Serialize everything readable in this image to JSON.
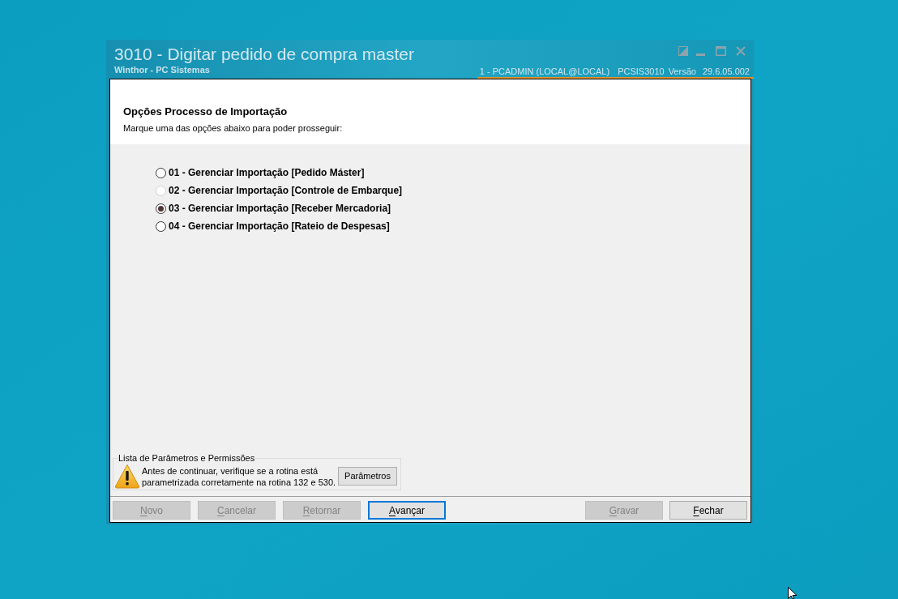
{
  "window": {
    "title": "3010 - Digitar pedido de compra master",
    "subtitle": "Winthor - PC Sistemas",
    "session": {
      "user": "1 - PCADMIN (LOCAL@LOCAL)",
      "routine": "PCSIS3010",
      "version_label": "Versão",
      "version": "29.6.05.002"
    }
  },
  "header": {
    "title": "Opções Processo de Importação",
    "instruction": "Marque uma das opções abaixo para poder prosseguir:"
  },
  "options": [
    {
      "label": "01 - Gerenciar Importação [Pedido Máster]",
      "selected": false,
      "disabled": false
    },
    {
      "label": "02 - Gerenciar Importação [Controle de Embarque]",
      "selected": false,
      "disabled": true
    },
    {
      "label": "03 - Gerenciar Importação [Receber Mercadoria]",
      "selected": true,
      "disabled": false
    },
    {
      "label": "04 - Gerenciar Importação [Rateio de Despesas]",
      "selected": false,
      "disabled": false
    }
  ],
  "parameters_group": {
    "legend": "Lista de Parâmetros e Permissões",
    "message_lines": [
      "Antes de continuar, verifique se a rotina está",
      "parametrizada corretamente na rotina 132 e 530."
    ],
    "button": "Parâmetros"
  },
  "buttons_left": [
    {
      "label": "Novo",
      "mnemonic_underlined": true,
      "disabled": true,
      "focused": false
    },
    {
      "label": "Cancelar",
      "mnemonic_underlined": true,
      "disabled": true,
      "focused": false
    },
    {
      "label": "Retornar",
      "mnemonic_underlined": true,
      "disabled": true,
      "focused": false
    },
    {
      "label": "Avançar",
      "mnemonic_underlined": true,
      "disabled": false,
      "focused": true
    }
  ],
  "buttons_right": [
    {
      "label": "Gravar",
      "mnemonic_underlined": true,
      "disabled": true,
      "focused": false
    },
    {
      "label": "Fechar",
      "mnemonic_underlined": true,
      "disabled": false,
      "focused": false
    }
  ]
}
